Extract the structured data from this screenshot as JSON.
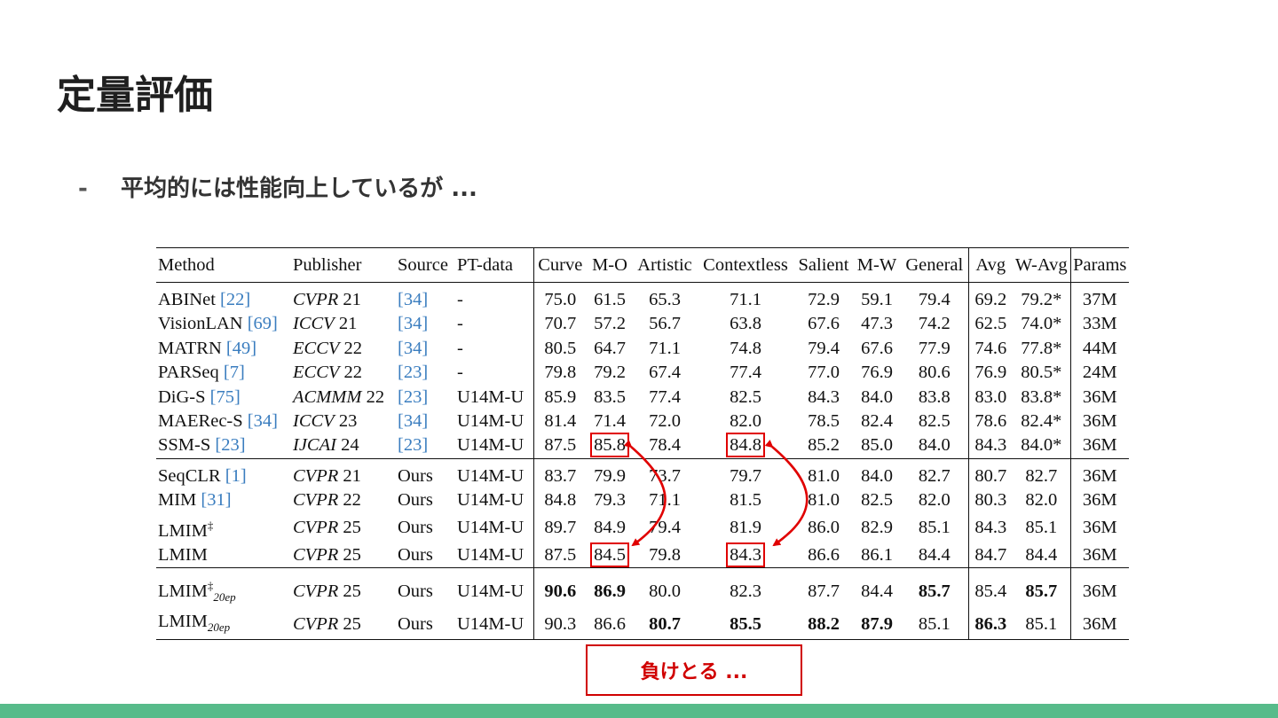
{
  "slide": {
    "title": "定量評価",
    "bullet_marker": "-",
    "bullet_text": "平均的には性能向上しているが ...",
    "callout_text": "負けとる ...",
    "accent_color": "#57bb8a",
    "highlight_color": "#e00000"
  },
  "table": {
    "headers": [
      "Method",
      "Publisher",
      "Source",
      "PT-data",
      "Curve",
      "M-O",
      "Artistic",
      "Contextless",
      "Salient",
      "M-W",
      "General",
      "Avg",
      "W-Avg",
      "Params"
    ],
    "rows": [
      {
        "method": "ABINet",
        "method_ref": "[22]",
        "pub_venue": "CVPR",
        "pub_year": "21",
        "source": "[34]",
        "pt": "-",
        "curve": "75.0",
        "mo": "61.5",
        "artistic": "65.3",
        "contextless": "71.1",
        "salient": "72.9",
        "mw": "59.1",
        "general": "79.4",
        "avg": "69.2",
        "wavg": "79.2*",
        "params": "37M"
      },
      {
        "method": "VisionLAN",
        "method_ref": "[69]",
        "pub_venue": "ICCV",
        "pub_year": "21",
        "source": "[34]",
        "pt": "-",
        "curve": "70.7",
        "mo": "57.2",
        "artistic": "56.7",
        "contextless": "63.8",
        "salient": "67.6",
        "mw": "47.3",
        "general": "74.2",
        "avg": "62.5",
        "wavg": "74.0*",
        "params": "33M"
      },
      {
        "method": "MATRN",
        "method_ref": "[49]",
        "pub_venue": "ECCV",
        "pub_year": "22",
        "source": "[34]",
        "pt": "-",
        "curve": "80.5",
        "mo": "64.7",
        "artistic": "71.1",
        "contextless": "74.8",
        "salient": "79.4",
        "mw": "67.6",
        "general": "77.9",
        "avg": "74.6",
        "wavg": "77.8*",
        "params": "44M"
      },
      {
        "method": "PARSeq",
        "method_ref": "[7]",
        "pub_venue": "ECCV",
        "pub_year": "22",
        "source": "[23]",
        "pt": "-",
        "curve": "79.8",
        "mo": "79.2",
        "artistic": "67.4",
        "contextless": "77.4",
        "salient": "77.0",
        "mw": "76.9",
        "general": "80.6",
        "avg": "76.9",
        "wavg": "80.5*",
        "params": "24M"
      },
      {
        "method": "DiG-S",
        "method_ref": "[75]",
        "pub_venue": "ACMMM",
        "pub_year": "22",
        "source": "[23]",
        "pt": "U14M-U",
        "curve": "85.9",
        "mo": "83.5",
        "artistic": "77.4",
        "contextless": "82.5",
        "salient": "84.3",
        "mw": "84.0",
        "general": "83.8",
        "avg": "83.0",
        "wavg": "83.8*",
        "params": "36M"
      },
      {
        "method": "MAERec-S",
        "method_ref": "[34]",
        "pub_venue": "ICCV",
        "pub_year": "23",
        "source": "[34]",
        "pt": "U14M-U",
        "curve": "81.4",
        "mo": "71.4",
        "artistic": "72.0",
        "contextless": "82.0",
        "salient": "78.5",
        "mw": "82.4",
        "general": "82.5",
        "avg": "78.6",
        "wavg": "82.4*",
        "params": "36M"
      },
      {
        "method": "SSM-S",
        "method_ref": "[23]",
        "pub_venue": "IJCAI",
        "pub_year": "24",
        "source": "[23]",
        "pt": "U14M-U",
        "curve": "87.5",
        "mo": "85.8",
        "artistic": "78.4",
        "contextless": "84.8",
        "salient": "85.2",
        "mw": "85.0",
        "general": "84.0",
        "avg": "84.3",
        "wavg": "84.0*",
        "params": "36M"
      },
      {
        "method": "SeqCLR",
        "method_ref": "[1]",
        "pub_venue": "CVPR",
        "pub_year": "21",
        "source": "Ours",
        "pt": "U14M-U",
        "curve": "83.7",
        "mo": "79.9",
        "artistic": "73.7",
        "contextless": "79.7",
        "salient": "81.0",
        "mw": "84.0",
        "general": "82.7",
        "avg": "80.7",
        "wavg": "82.7",
        "params": "36M"
      },
      {
        "method": "MIM",
        "method_ref": "[31]",
        "pub_venue": "CVPR",
        "pub_year": "22",
        "source": "Ours",
        "pt": "U14M-U",
        "curve": "84.8",
        "mo": "79.3",
        "artistic": "71.1",
        "contextless": "81.5",
        "salient": "81.0",
        "mw": "82.5",
        "general": "82.0",
        "avg": "80.3",
        "wavg": "82.0",
        "params": "36M"
      },
      {
        "method": "LMIM",
        "method_sup": "‡",
        "pub_venue": "CVPR",
        "pub_year": "25",
        "source": "Ours",
        "pt": "U14M-U",
        "curve": "89.7",
        "mo": "84.9",
        "artistic": "79.4",
        "contextless": "81.9",
        "salient": "86.0",
        "mw": "82.9",
        "general": "85.1",
        "avg": "84.3",
        "wavg": "85.1",
        "params": "36M"
      },
      {
        "method": "LMIM",
        "pub_venue": "CVPR",
        "pub_year": "25",
        "source": "Ours",
        "pt": "U14M-U",
        "curve": "87.5",
        "mo": "84.5",
        "artistic": "79.8",
        "contextless": "84.3",
        "salient": "86.6",
        "mw": "86.1",
        "general": "84.4",
        "avg": "84.7",
        "wavg": "84.4",
        "params": "36M"
      },
      {
        "method": "LMIM",
        "method_sup": "‡",
        "method_sub": "20ep",
        "pub_venue": "CVPR",
        "pub_year": "25",
        "source": "Ours",
        "pt": "U14M-U",
        "curve": "90.6",
        "mo": "86.9",
        "artistic": "80.0",
        "contextless": "82.3",
        "salient": "87.7",
        "mw": "84.4",
        "general": "85.7",
        "avg": "85.4",
        "wavg": "85.7",
        "params": "36M"
      },
      {
        "method": "LMIM",
        "method_sub": "20ep",
        "pub_venue": "CVPR",
        "pub_year": "25",
        "source": "Ours",
        "pt": "U14M-U",
        "curve": "90.3",
        "mo": "86.6",
        "artistic": "80.7",
        "contextless": "85.5",
        "salient": "88.2",
        "mw": "87.9",
        "general": "85.1",
        "avg": "86.3",
        "wavg": "85.1",
        "params": "36M"
      }
    ]
  }
}
